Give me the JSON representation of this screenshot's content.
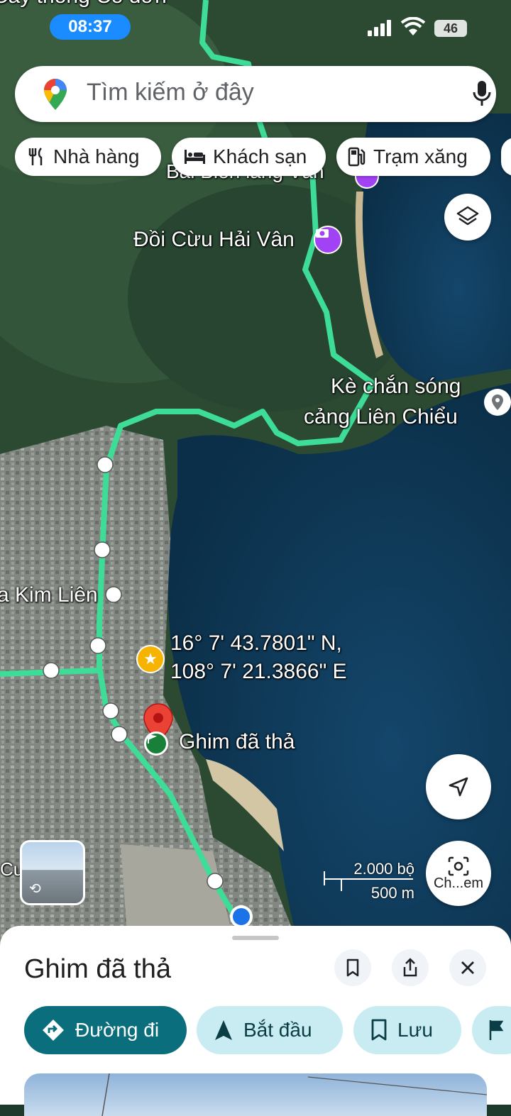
{
  "status_bar": {
    "time": "08:37",
    "battery": "46"
  },
  "search": {
    "placeholder": "Tìm kiếm ở đây"
  },
  "chips": [
    {
      "label": "Nhà hàng",
      "icon": "restaurant-icon"
    },
    {
      "label": "Khách sạn",
      "icon": "hotel-icon"
    },
    {
      "label": "Trạm xăng",
      "icon": "gas-station-icon"
    }
  ],
  "map": {
    "labels": {
      "top_partial": "Cây thông Cô đơn",
      "beach": "Bãi Biển làng Vân",
      "doi_cuu": "Đồi Cừu Hải Vân",
      "ke_chan_song_1": "Kè chắn sóng",
      "ke_chan_song_2": "cảng Liên Chiểu",
      "kim_lien": "a Kim Liên",
      "cu": "Cu",
      "coord_line1": "16° 7' 43.7801\" N,",
      "coord_line2": "108° 7' 21.3866\" E",
      "dropped_pin": "Ghim đã thả"
    },
    "scale": {
      "imperial": "2.000 bộ",
      "metric": "500 m"
    },
    "lens_label": "Ch...em",
    "colors": {
      "route": "#3ddc97",
      "water": "#0e3a5a",
      "pin": "#ea4335",
      "location_dot": "#1a73e8"
    }
  },
  "sheet": {
    "title": "Ghim đã thả",
    "actions": [
      {
        "label": "Đường đi",
        "icon": "directions-icon"
      },
      {
        "label": "Bắt đầu",
        "icon": "navigation-icon"
      },
      {
        "label": "Lưu",
        "icon": "bookmark-icon"
      }
    ]
  }
}
